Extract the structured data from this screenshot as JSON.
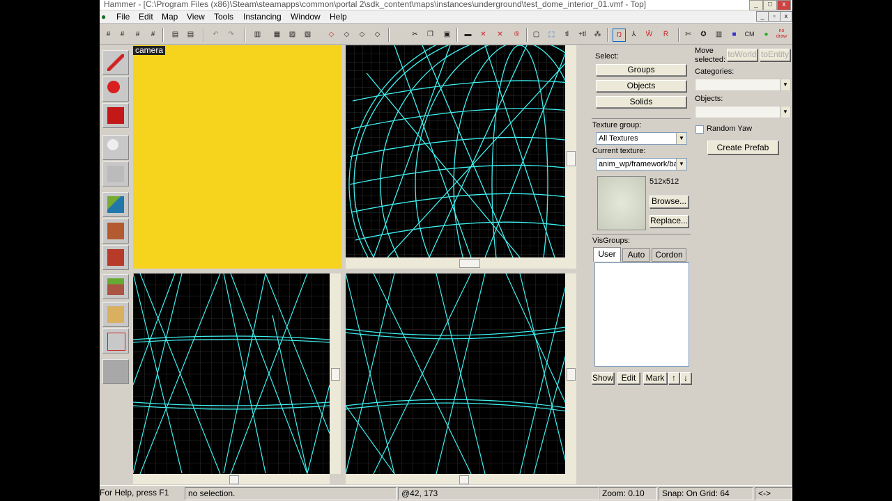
{
  "title": "Hammer - [C:\\Program Files (x86)\\Steam\\steamapps\\common\\portal 2\\sdk_content\\maps\\instances\\underground\\test_dome_interior_01.vmf - Top]",
  "menu": [
    "File",
    "Edit",
    "Map",
    "View",
    "Tools",
    "Instancing",
    "Window",
    "Help"
  ],
  "toolbar_icons": [
    "grid-icon",
    "grid-toggle-icon",
    "grid-dec-icon",
    "grid-inc-icon",
    "group-icon",
    "ungroup-icon",
    "undo-icon",
    "redo-icon",
    "carve-icon",
    "cut-icon",
    "copy-icon",
    "paste-icon",
    "select-icon",
    "texture-lock-icon",
    "cordon-icon",
    "run-map-icon",
    "help-icon"
  ],
  "camera_label": "camera",
  "select": {
    "label": "Select:",
    "groups": "Groups",
    "objects": "Objects",
    "solids": "Solids"
  },
  "move": {
    "label": "Move selected:",
    "to_world": "toWorld",
    "to_entity": "toEntity"
  },
  "categories_label": "Categories:",
  "objects_label": "Objects:",
  "random_yaw": "Random Yaw",
  "create_prefab": "Create Prefab",
  "texture": {
    "group_label": "Texture group:",
    "group_value": "All Textures",
    "current_label": "Current texture:",
    "current_value": "anim_wp/framework/ba",
    "size": "512x512",
    "browse": "Browse...",
    "replace": "Replace..."
  },
  "visgroups": {
    "label": "VisGroups:",
    "tabs": [
      "User",
      "Auto",
      "Cordon"
    ],
    "show": "Show",
    "edit": "Edit",
    "mark": "Mark",
    "up": "↑",
    "down": "↓"
  },
  "status": {
    "help": "For Help, press F1",
    "selection": "no selection.",
    "coords": "@42, 173",
    "zoom": "Zoom: 0.10",
    "snap": "Snap: On Grid: 64",
    "arrows": "<->"
  },
  "colors": {
    "wire": "#3ff0f0",
    "camera_bg": "#f6d31d",
    "grid": "#333"
  }
}
